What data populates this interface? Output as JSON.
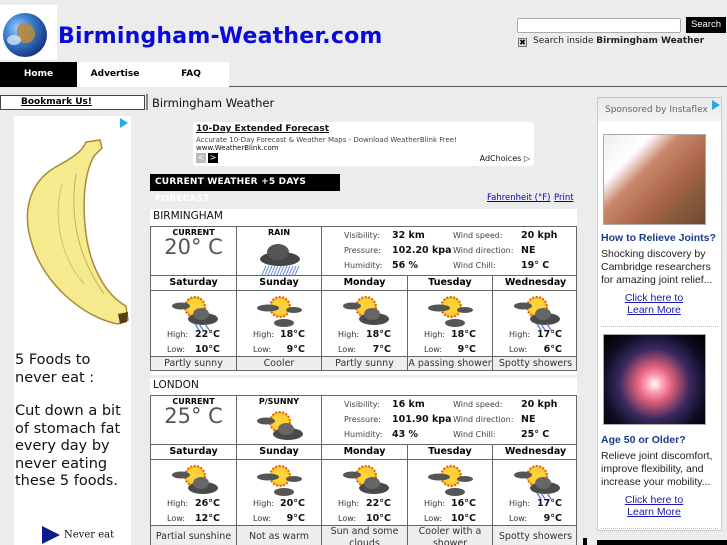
{
  "header": {
    "site_title": "Birmingham-Weather.com",
    "search": {
      "placeholder": "",
      "button_label": "Search",
      "checkbox_checked": true,
      "checkbox_glyph": "✖",
      "scope_prefix": "Search inside ",
      "scope_name": "Birmingham Weather"
    }
  },
  "nav": {
    "items": [
      {
        "label": "Home",
        "active": true
      },
      {
        "label": "Advertise",
        "active": false
      },
      {
        "label": "FAQ",
        "active": false
      }
    ]
  },
  "left": {
    "bookmark_label": "Bookmark Us!",
    "ad": {
      "headline": "5 Foods to never eat :",
      "body": "Cut down a bit of stomach fat every day by never eating these 5 foods.",
      "cta": "Never eat"
    }
  },
  "main": {
    "heading": "Birmingham Weather",
    "ad": {
      "title": "10-Day Extended Forecast",
      "description": "Accurate 10-Day Forecast & Weather Maps - Download WeatherBlink Free!",
      "url": "www.WeatherBlink.com",
      "prev_glyph": "<",
      "next_glyph": ">",
      "adchoices": "AdChoices"
    },
    "section_heading": "CURRENT WEATHER +5 DAYS FORECAST",
    "units_link": "Fahrenheit (°F)",
    "print_link": "Print",
    "labels": {
      "current": "CURRENT",
      "visibility": "Visibility:",
      "pressure": "Pressure:",
      "humidity": "Humidity:",
      "wind_speed": "Wind speed:",
      "wind_direction": "Wind direction:",
      "wind_chill": "Wind Chill:",
      "high": "High:",
      "low": "Low:"
    },
    "cities": [
      {
        "name": "BIRMINGHAM",
        "current_temp": "20° C",
        "condition": "RAIN",
        "condition_icon": "rain-cloud-icon",
        "visibility": "32 km",
        "pressure": "102.20 kpa",
        "humidity": "56 %",
        "wind_speed": "20 kph",
        "wind_direction": "NE",
        "wind_chill": "19° C",
        "forecast": [
          {
            "day": "Saturday",
            "icon": "sun-cloud-rain-icon",
            "high": "22°C",
            "low": "10°C",
            "summary": "Partly sunny"
          },
          {
            "day": "Sunday",
            "icon": "sun-clouds-icon",
            "high": "18°C",
            "low": "9°C",
            "summary": "Cooler"
          },
          {
            "day": "Monday",
            "icon": "sun-cloud-icon",
            "high": "18°C",
            "low": "7°C",
            "summary": "Partly sunny"
          },
          {
            "day": "Tuesday",
            "icon": "sun-clouds-icon",
            "high": "18°C",
            "low": "9°C",
            "summary": "A passing shower"
          },
          {
            "day": "Wednesday",
            "icon": "sun-cloud-rain-icon",
            "high": "17°C",
            "low": "6°C",
            "summary": "Spotty showers"
          }
        ]
      },
      {
        "name": "LONDON",
        "current_temp": "25° C",
        "condition": "P/SUNNY",
        "condition_icon": "sun-cloud-icon",
        "visibility": "16 km",
        "pressure": "101.90 kpa",
        "humidity": "43 %",
        "wind_speed": "20 kph",
        "wind_direction": "NE",
        "wind_chill": "25° C",
        "forecast": [
          {
            "day": "Saturday",
            "icon": "sun-cloud-icon",
            "high": "26°C",
            "low": "12°C",
            "summary": "Partial sunshine"
          },
          {
            "day": "Sunday",
            "icon": "sun-clouds-icon",
            "high": "20°C",
            "low": "9°C",
            "summary": "Not as warm"
          },
          {
            "day": "Monday",
            "icon": "sun-cloud-icon",
            "high": "22°C",
            "low": "10°C",
            "summary": "Sun and some clouds"
          },
          {
            "day": "Tuesday",
            "icon": "sun-clouds-icon",
            "high": "16°C",
            "low": "10°C",
            "summary": "Cooler with a shower"
          },
          {
            "day": "Wednesday",
            "icon": "sun-cloud-rain-icon",
            "high": "17°C",
            "low": "9°C",
            "summary": "Spotty showers"
          }
        ]
      }
    ]
  },
  "right": {
    "sponsor": "Sponsored by Instaflex",
    "ads": [
      {
        "title": "How to Relieve Joints?",
        "text": "Shocking discovery by Cambridge researchers for amazing joint relief...",
        "link_line1": "Click here to",
        "link_line2": "Learn More"
      },
      {
        "title": "Age 50 or Older?",
        "text": "Relieve joint discomfort, improve flexibility, and increase your mobility...",
        "link_line1": "Click here to",
        "link_line2": "Learn More"
      }
    ]
  }
}
